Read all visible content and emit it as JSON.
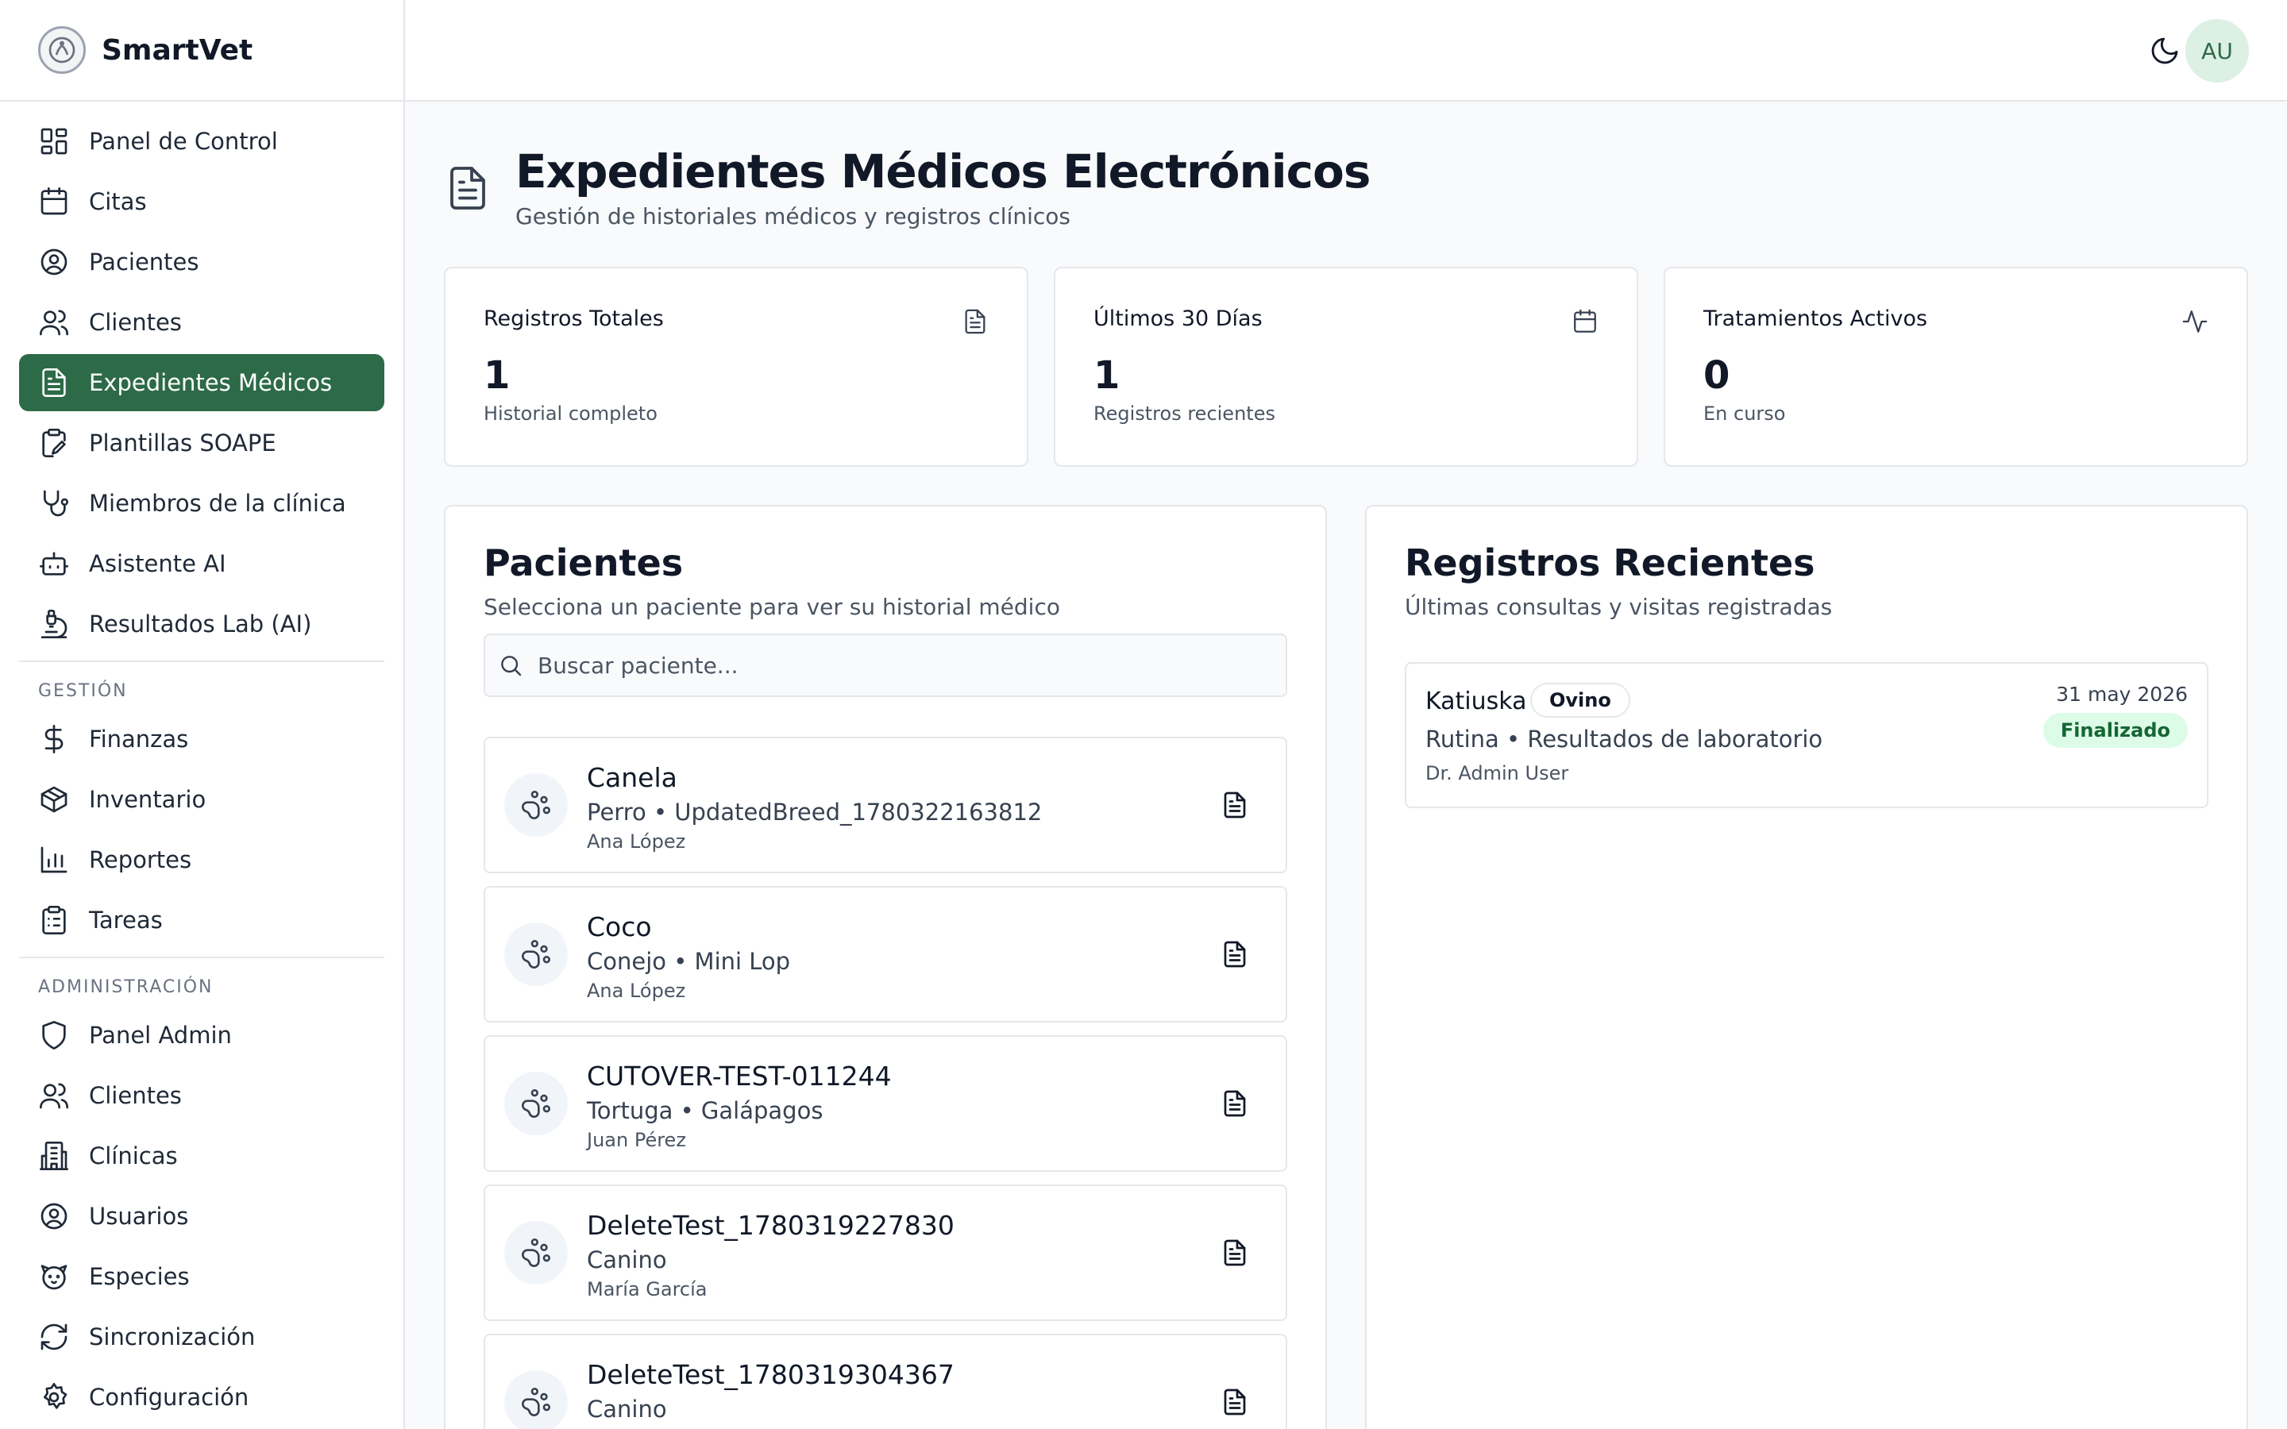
{
  "app": {
    "name": "SmartVet"
  },
  "sidebar": {
    "items": [
      {
        "label": "Panel de Control",
        "icon": "layout-dashboard-icon"
      },
      {
        "label": "Citas",
        "icon": "calendar-icon"
      },
      {
        "label": "Pacientes",
        "icon": "user-circle-icon"
      },
      {
        "label": "Clientes",
        "icon": "users-icon"
      },
      {
        "label": "Expedientes Médicos",
        "icon": "file-text-icon",
        "active": true
      },
      {
        "label": "Plantillas SOAPE",
        "icon": "clipboard-pen-icon"
      },
      {
        "label": "Miembros de la clínica",
        "icon": "stethoscope-icon"
      },
      {
        "label": "Asistente AI",
        "icon": "bot-icon"
      },
      {
        "label": "Resultados Lab (AI)",
        "icon": "microscope-icon"
      }
    ],
    "gestion_heading": "GESTIÓN",
    "gestion_items": [
      {
        "label": "Finanzas",
        "icon": "dollar-sign-icon"
      },
      {
        "label": "Inventario",
        "icon": "package-icon"
      },
      {
        "label": "Reportes",
        "icon": "bar-chart-icon"
      },
      {
        "label": "Tareas",
        "icon": "clipboard-list-icon"
      }
    ],
    "admin_heading": "ADMINISTRACIÓN",
    "admin_items": [
      {
        "label": "Panel Admin",
        "icon": "shield-icon"
      },
      {
        "label": "Clientes",
        "icon": "users-icon"
      },
      {
        "label": "Clínicas",
        "icon": "building-icon"
      },
      {
        "label": "Usuarios",
        "icon": "user-circle-icon"
      },
      {
        "label": "Especies",
        "icon": "dog-icon"
      },
      {
        "label": "Sincronización",
        "icon": "refresh-icon"
      },
      {
        "label": "Configuración",
        "icon": "settings-icon"
      }
    ]
  },
  "topbar": {
    "avatar_initials": "AU",
    "theme_icon": "moon-icon"
  },
  "page": {
    "title": "Expedientes Médicos Electrónicos",
    "subtitle": "Gestión de historiales médicos y registros clínicos"
  },
  "stats": [
    {
      "label": "Registros Totales",
      "value": "1",
      "desc": "Historial completo",
      "icon": "file-text-icon"
    },
    {
      "label": "Últimos 30 Días",
      "value": "1",
      "desc": "Registros recientes",
      "icon": "calendar-icon"
    },
    {
      "label": "Tratamientos Activos",
      "value": "0",
      "desc": "En curso",
      "icon": "activity-icon"
    }
  ],
  "patients_panel": {
    "title": "Pacientes",
    "subtitle": "Selecciona un paciente para ver su historial médico",
    "search_placeholder": "Buscar paciente...",
    "patients": [
      {
        "name": "Canela",
        "species": "Perro • UpdatedBreed_1780322163812",
        "owner": "Ana López"
      },
      {
        "name": "Coco",
        "species": "Conejo • Mini Lop",
        "owner": "Ana López"
      },
      {
        "name": "CUTOVER-TEST-011244",
        "species": "Tortuga • Galápagos",
        "owner": "Juan Pérez"
      },
      {
        "name": "DeleteTest_1780319227830",
        "species": "Canino",
        "owner": "María García"
      },
      {
        "name": "DeleteTest_1780319304367",
        "species": "Canino",
        "owner": ""
      }
    ]
  },
  "records_panel": {
    "title": "Registros Recientes",
    "subtitle": "Últimas consultas y visitas registradas",
    "records": [
      {
        "patient": "Katiuska",
        "species": "Ovino",
        "type": "Rutina • Resultados de laboratorio",
        "doctor": "Dr. Admin User",
        "date": "31 may 2026",
        "status": "Finalizado"
      }
    ]
  },
  "colors": {
    "accent": "#2d6a48",
    "avatar_bg": "#dcf0e4",
    "status_bg": "#dcfce7",
    "status_text": "#166534"
  }
}
